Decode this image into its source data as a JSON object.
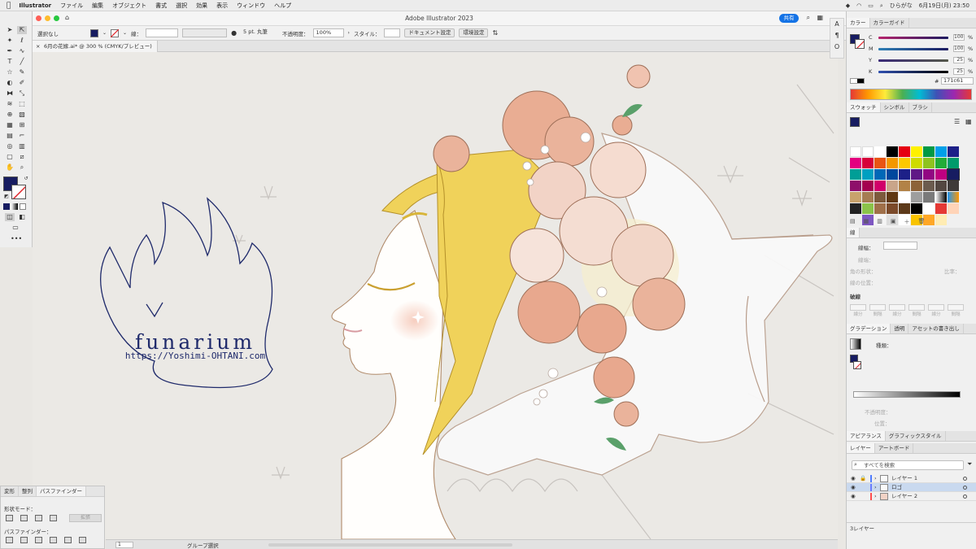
{
  "menubar": {
    "apple_icon": "apple-icon",
    "app_name": "Illustrator",
    "items": [
      "ファイル",
      "編集",
      "オブジェクト",
      "書式",
      "選択",
      "効果",
      "表示",
      "ウィンドウ",
      "ヘルプ"
    ],
    "ime": "ひらがな",
    "datetime": "6月19日(月) 23:50"
  },
  "window": {
    "title": "Adobe Illustrator 2023",
    "share_label": "共有",
    "doc_tab": "6月の花嫁.ai* @ 300 % (CMYK/プレビュー)",
    "close_glyph": "×"
  },
  "control": {
    "selection": "選択なし",
    "stroke_label": "線：",
    "brush": "5 pt. 丸筆",
    "opacity_label": "不透明度：",
    "opacity_value": "100%",
    "style_label": "スタイル：",
    "doc_settings": "ドキュメント設定",
    "env_settings": "環境設定"
  },
  "artwork": {
    "logo_name": "funarium",
    "logo_url": "https://Yoshimi-OHTANI.com"
  },
  "status": {
    "zoom_value": "1",
    "tool_name": "グループ選択",
    "page_value": "1"
  },
  "pathfinder": {
    "tabs": [
      "変形",
      "整列",
      "パスファインダー"
    ],
    "shape_mode_label": "形状モード：",
    "expand_label": "拡張",
    "pathfinder_label": "パスファインダー："
  },
  "color_panel": {
    "tabs": [
      "カラー",
      "カラーガイド"
    ],
    "channels": [
      {
        "name": "C",
        "value": "100",
        "unit": "%"
      },
      {
        "name": "M",
        "value": "100",
        "unit": "%"
      },
      {
        "name": "Y",
        "value": "25",
        "unit": "%"
      },
      {
        "name": "K",
        "value": "25",
        "unit": "%"
      }
    ],
    "hex_prefix": "#",
    "hex": "171c61",
    "fill_color": "#171c61"
  },
  "swatch_panel": {
    "tabs": [
      "スウォッチ",
      "シンボル",
      "ブラシ"
    ]
  },
  "stroke_panel": {
    "title": "線",
    "weight_label": "線幅：",
    "cap_label": "線端：",
    "corner_label": "角の形状：",
    "align_label": "線の位置：",
    "limit_label": "比率：",
    "dash_label": "破線",
    "dash_fields": [
      "線分",
      "間隔",
      "線分",
      "間隔",
      "線分",
      "間隔"
    ]
  },
  "gradient_panel": {
    "tabs": [
      "グラデーション",
      "透明",
      "アセットの書き出し"
    ],
    "type_label": "種類：",
    "opacity_label": "不透明度：",
    "position_label": "位置："
  },
  "appearance_panel": {
    "tabs": [
      "アピアランス",
      "グラフィックスタイル"
    ]
  },
  "layers_panel": {
    "tabs": [
      "レイヤー",
      "アートボード"
    ],
    "search_placeholder": "すべてを検索",
    "layers": [
      {
        "name": "レイヤー 1",
        "color": "#4f7cff",
        "selected": false,
        "locked": true
      },
      {
        "name": "ロゴ",
        "color": "#6a7cff",
        "selected": true,
        "locked": false
      },
      {
        "name": "レイヤー 2",
        "color": "#ff4d4d",
        "selected": false,
        "locked": false
      }
    ],
    "count_label": "3レイヤー"
  }
}
